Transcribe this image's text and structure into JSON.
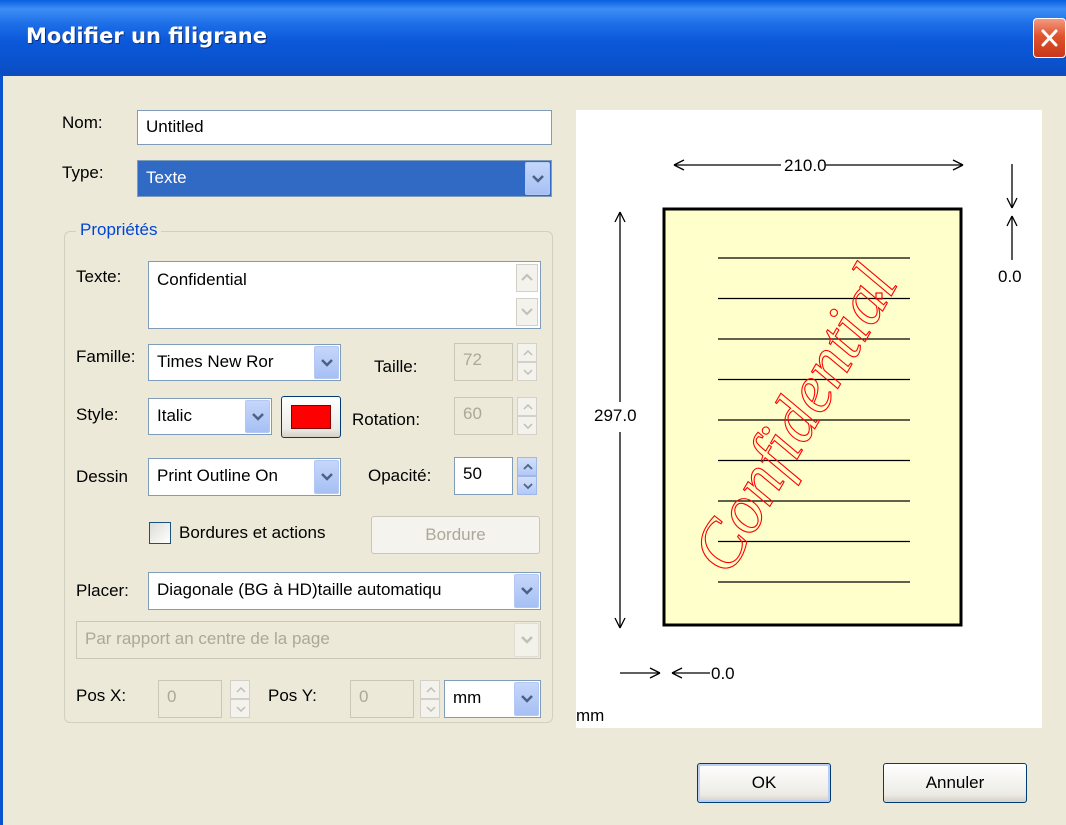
{
  "window": {
    "title": "Modifier un filigrane"
  },
  "form": {
    "nom_label": "Nom:",
    "nom_value": "Untitled",
    "type_label": "Type:",
    "type_value": "Texte"
  },
  "properties": {
    "legend": "Propriétés",
    "texte_label": "Texte:",
    "texte_value": "Confidential",
    "famille_label": "Famille:",
    "famille_value": "Times New Ror",
    "taille_label": "Taille:",
    "taille_value": "72",
    "style_label": "Style:",
    "style_value": "Italic",
    "color": "#ff0000",
    "rotation_label": "Rotation:",
    "rotation_value": "60",
    "dessin_label": "Dessin",
    "dessin_value": "Print Outline On",
    "opacite_label": "Opacité:",
    "opacite_value": "50",
    "bordures_label": "Bordures et actions",
    "bordures_checked": false,
    "bordure_button": "Bordure",
    "placer_label": "Placer:",
    "placer_value": "Diagonale (BG à HD)taille automatiqu",
    "relative_value": "Par rapport an centre de la page",
    "posx_label": "Pos X:",
    "posx_value": "0",
    "posy_label": "Pos Y:",
    "posy_value": "0",
    "unit_value": "mm"
  },
  "preview": {
    "width_label": "210.0",
    "height_label": "297.0",
    "top_offset_label": "0.0",
    "left_offset_label": "0.0",
    "unit_label": "mm",
    "watermark_text": "Confidential",
    "page_color": "#ffffcc",
    "line_count": 9
  },
  "buttons": {
    "ok": "OK",
    "cancel": "Annuler"
  },
  "colors": {
    "titlebar": "#0a53cf",
    "dialog_bg": "#ece9d8",
    "group_legend": "#0046d5"
  }
}
